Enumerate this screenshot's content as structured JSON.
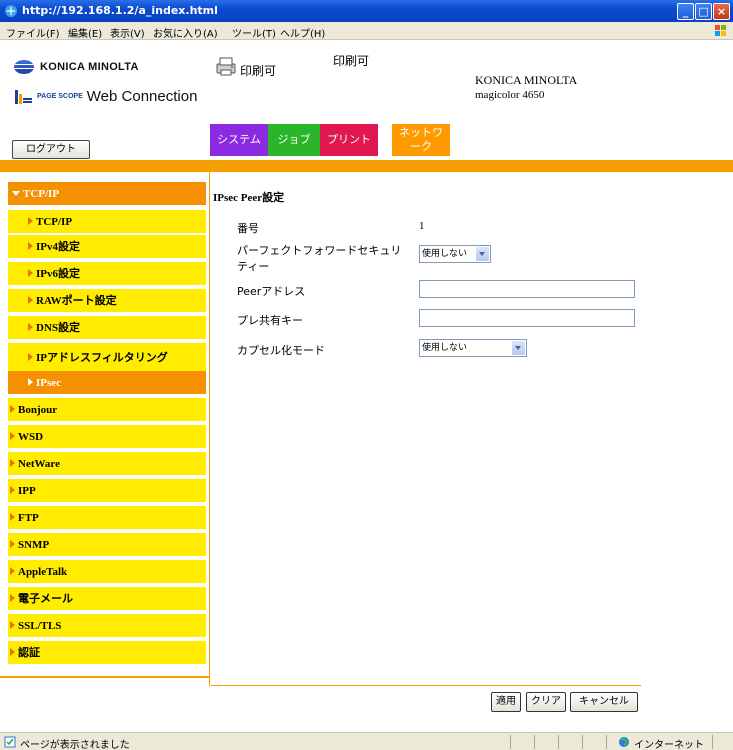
{
  "window": {
    "title": "http://192.168.1.2/a_index.html"
  },
  "menu": [
    "ファイル(F)",
    "編集(E)",
    "表示(V)",
    "お気に入り(A)",
    "ツール(T)",
    "ヘルプ(H)"
  ],
  "header": {
    "brand": "KONICA MINOLTA",
    "pagescope": "PAGE SCOPE",
    "product": "Web Connection",
    "status_primary": "印刷可",
    "status_secondary": "印刷可",
    "device_brand": "KONICA MINOLTA",
    "device_model": "magicolor 4650",
    "logout_label": "ログアウト"
  },
  "tabs": {
    "system": "システム",
    "job": "ジョブ",
    "print": "プリント",
    "network": "ネットワーク"
  },
  "sidebar": {
    "items": [
      {
        "label": "TCP/IP"
      },
      {
        "label": "TCP/IP"
      },
      {
        "label": "IPv4設定"
      },
      {
        "label": "IPv6設定"
      },
      {
        "label": "RAWポート設定"
      },
      {
        "label": "DNS設定"
      },
      {
        "label": "IPアドレスフィルタリング"
      },
      {
        "label": "IPsec"
      },
      {
        "label": "Bonjour"
      },
      {
        "label": "WSD"
      },
      {
        "label": "NetWare"
      },
      {
        "label": "IPP"
      },
      {
        "label": "FTP"
      },
      {
        "label": "SNMP"
      },
      {
        "label": "AppleTalk"
      },
      {
        "label": "電子メール"
      },
      {
        "label": "SSL/TLS"
      },
      {
        "label": "認証"
      }
    ]
  },
  "form": {
    "title": "IPsec Peer設定",
    "number_label": "番号",
    "number_value": "1",
    "pfs_label_line1": "パーフェクトフォワードセキュリ",
    "pfs_label_line2": "ティー",
    "pfs_value": "使用しない",
    "peer_address_label": "Peerアドレス",
    "peer_address_value": "",
    "preshared_key_label": "プレ共有キー",
    "preshared_key_value": "",
    "encap_mode_label": "カプセル化モード",
    "encap_mode_value": "使用しない"
  },
  "buttons": {
    "apply": "適用",
    "clear": "クリア",
    "cancel": "キャンセル"
  },
  "statusbar": {
    "message": "ページが表示されました",
    "zone": "インターネット"
  }
}
